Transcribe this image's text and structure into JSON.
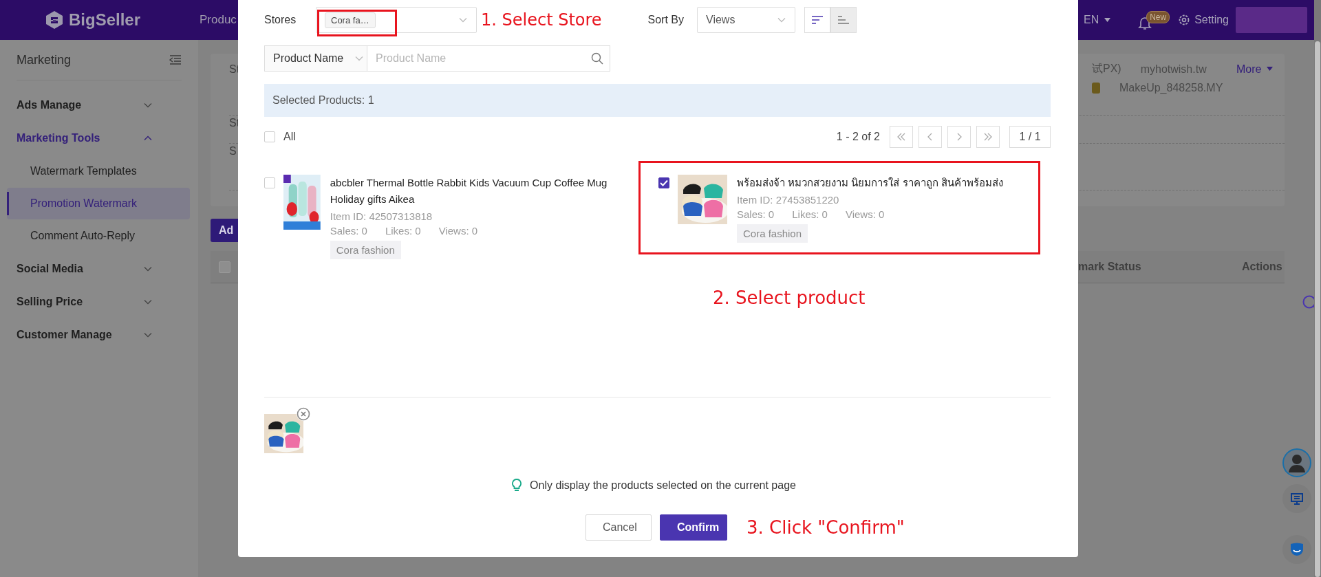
{
  "header": {
    "logo": "BigSeller",
    "nav_item": "Produc",
    "language": "EN",
    "notification_badge": "New",
    "settings": "Setting"
  },
  "sidebar": {
    "title": "Marketing",
    "items": [
      {
        "label": "Ads Manage",
        "expanded": false,
        "selected": false
      },
      {
        "label": "Marketing Tools",
        "expanded": true,
        "selected": true,
        "children": [
          {
            "label": "Watermark Templates",
            "selected": false
          },
          {
            "label": "Promotion Watermark",
            "selected": true
          },
          {
            "label": "Comment Auto-Reply",
            "selected": false
          }
        ]
      },
      {
        "label": "Social Media",
        "expanded": false,
        "selected": false
      },
      {
        "label": "Selling Price",
        "expanded": false,
        "selected": false
      },
      {
        "label": "Customer Manage",
        "expanded": false,
        "selected": false
      }
    ]
  },
  "page": {
    "filter_rows": [
      {
        "label": "St",
        "lines": [
          [
            "试PX)",
            "myhotwish.tw"
          ],
          [
            "MakeUp_848258.MY"
          ]
        ],
        "more": "More"
      },
      {
        "label": "St"
      },
      {
        "label": "S"
      }
    ],
    "add_button": "Ad",
    "table": {
      "select_all_checked": false,
      "columns": [
        "mark Status",
        "Actions"
      ]
    }
  },
  "modal": {
    "stores": {
      "label": "Stores",
      "chips": [
        "Cora fa…"
      ],
      "annotated": true,
      "annotation": "1. Select Store"
    },
    "sort": {
      "label": "Sort By",
      "value": "Views",
      "order_buttons": [
        {
          "kind": "descending",
          "selected": true
        },
        {
          "kind": "ascending",
          "selected": false
        }
      ]
    },
    "search": {
      "field": "Product Name",
      "placeholder": "Product Name"
    },
    "selected_count": "Selected Products: 1",
    "select_all": {
      "label": "All",
      "checked": false
    },
    "pagination": {
      "range": "1 - 2 of 2",
      "page": "1 / 1"
    },
    "products": [
      {
        "title": "abcbler Thermal Bottle Rabbit Kids Vacuum Cup Coffee Mug Holiday gifts Aikea",
        "item_id": "Item ID: 42507313818",
        "stats": [
          "Sales: 0",
          "Likes: 0",
          "Views: 0"
        ],
        "store": "Cora fashion",
        "checked": false,
        "annotated": false
      },
      {
        "title": "พร้อมส่งจ้า หมวกสวยงาม นิยมการใส่ ราคาถูก สินค้าพร้อมส่ง",
        "item_id": "Item ID: 27453851220",
        "stats": [
          "Sales: 0",
          "Likes: 0",
          "Views: 0"
        ],
        "store": "Cora fashion",
        "checked": true,
        "annotated": true
      }
    ],
    "product_annotation": "2. Select product",
    "tip": "Only display the products selected on the current page",
    "buttons": [
      {
        "label": "Cancel",
        "kind": "secondary"
      },
      {
        "label": "Confirm",
        "kind": "primary"
      }
    ],
    "confirm_annotation": "3. Click \"Confirm\""
  }
}
